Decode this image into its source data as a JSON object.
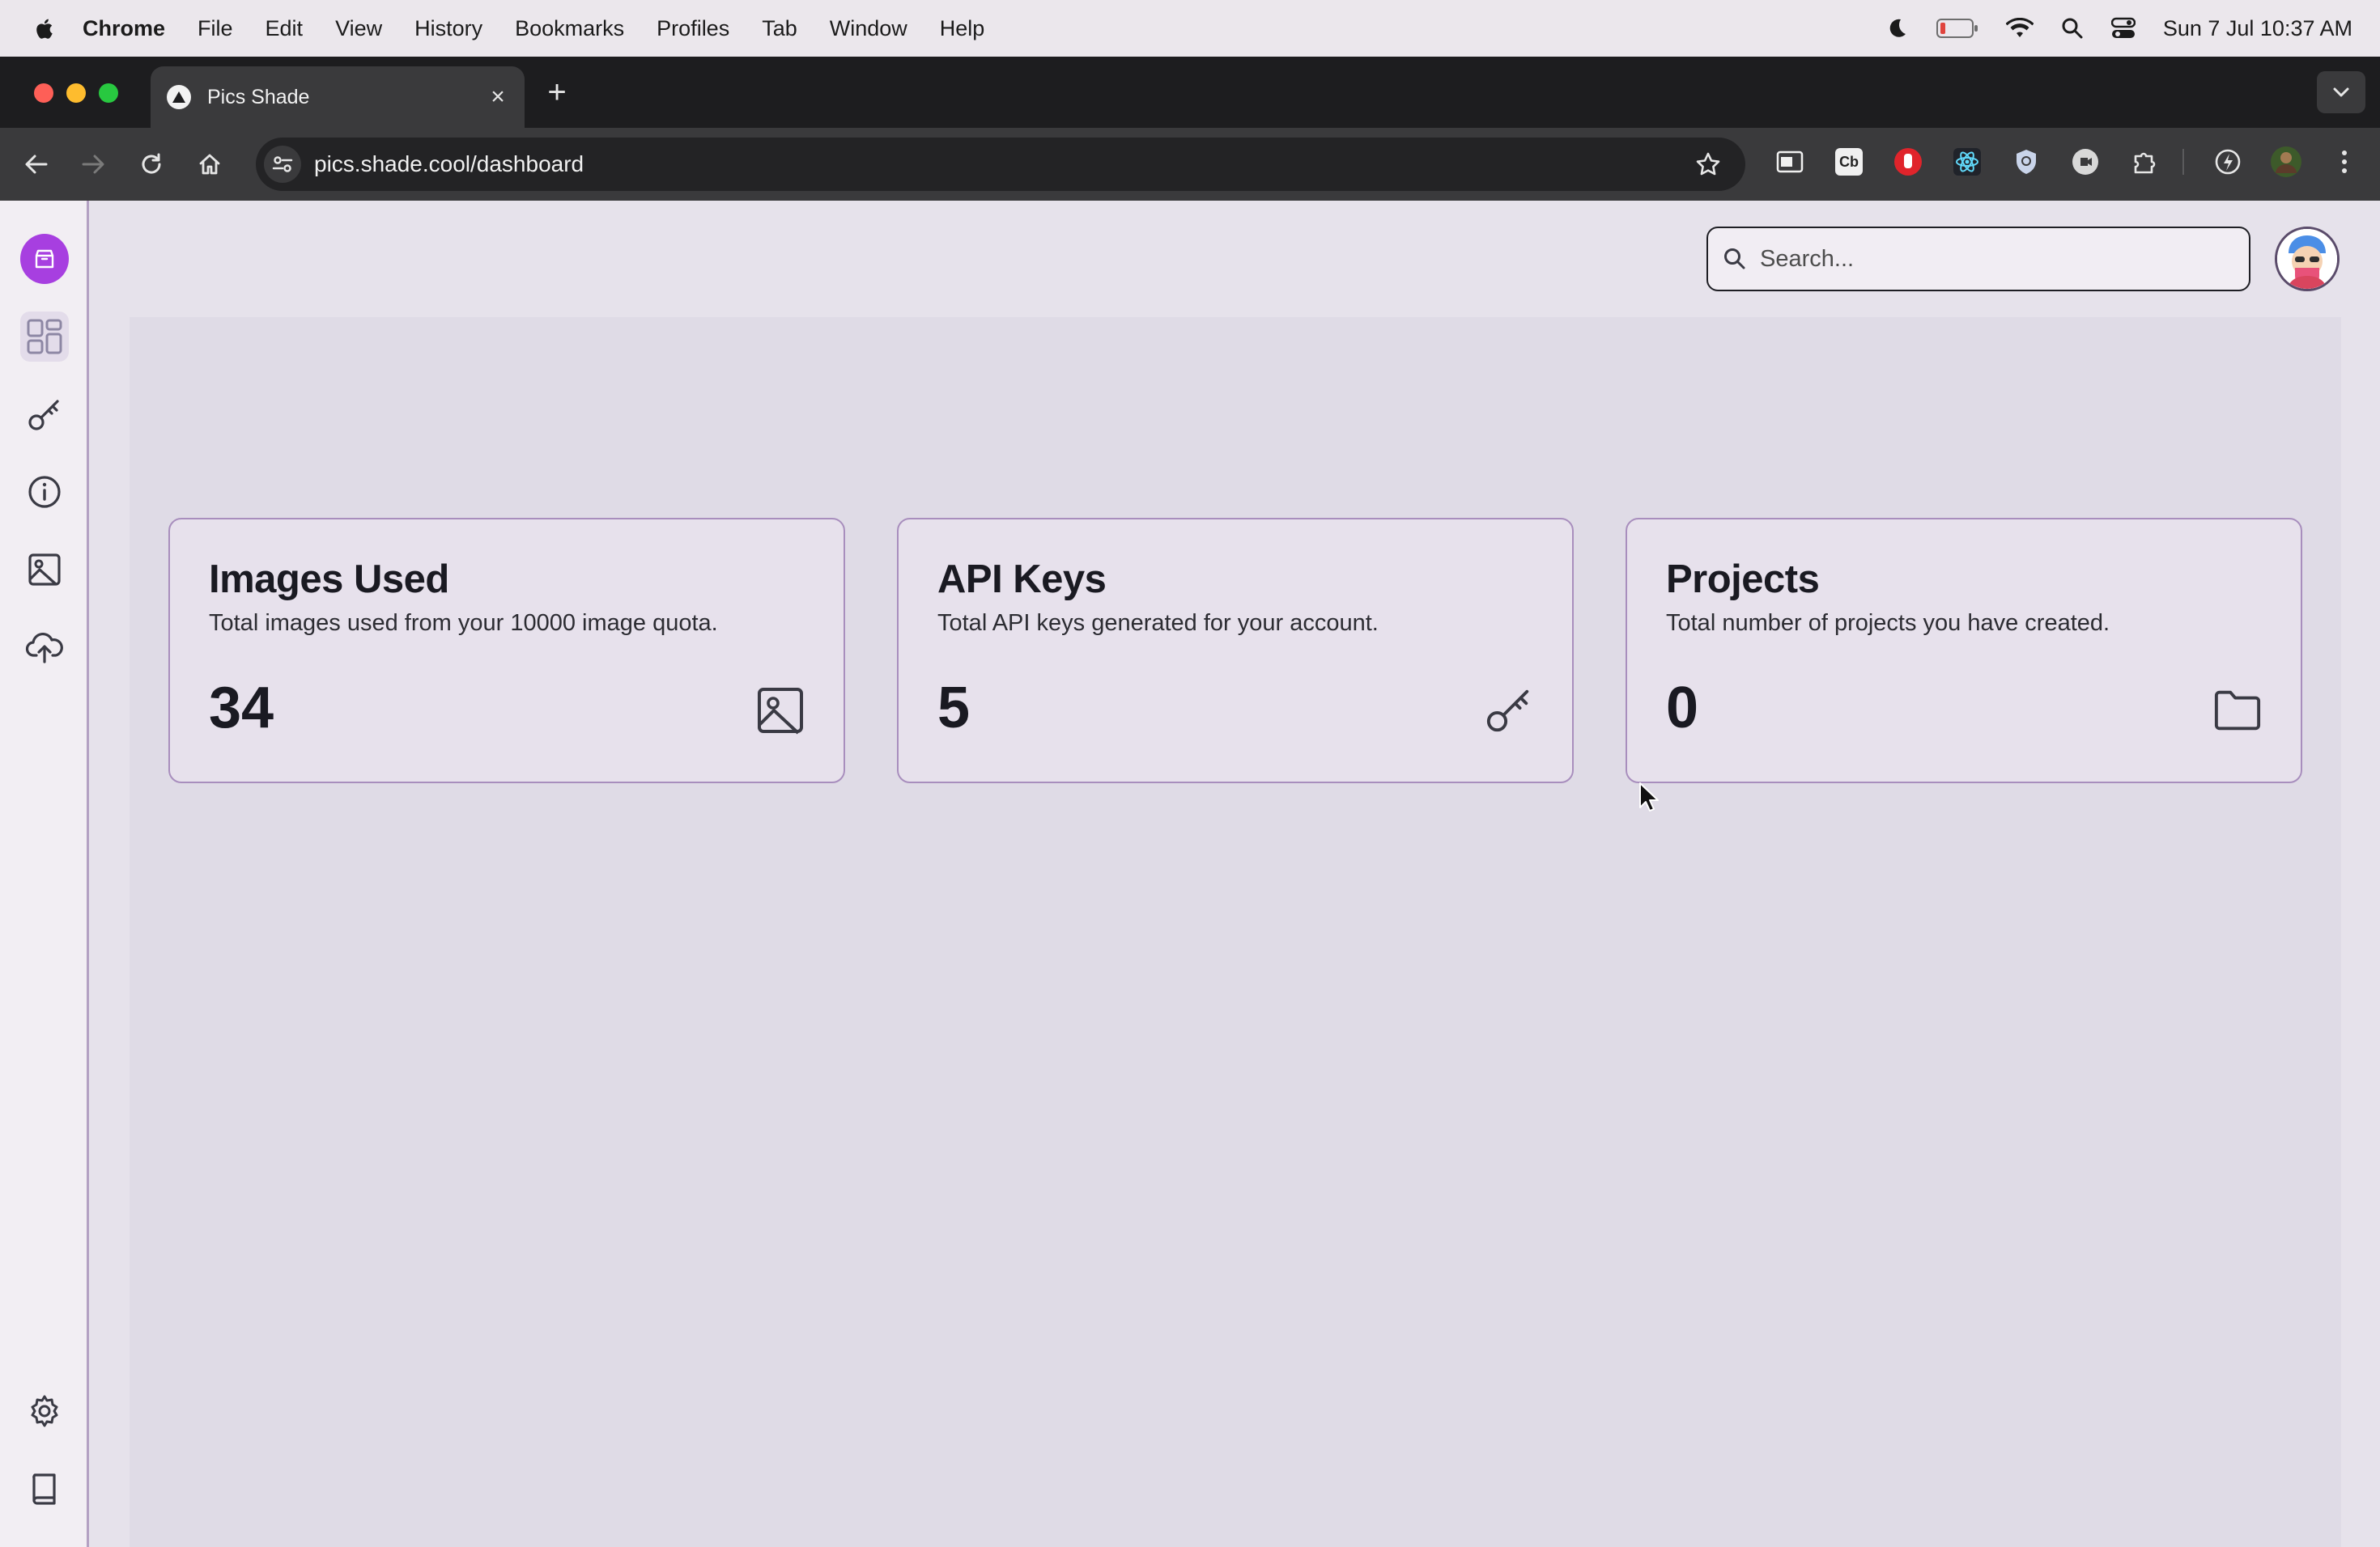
{
  "menubar": {
    "app": "Chrome",
    "items": [
      "File",
      "Edit",
      "View",
      "History",
      "Bookmarks",
      "Profiles",
      "Tab",
      "Window",
      "Help"
    ],
    "clock": "Sun 7 Jul  10:37 AM"
  },
  "browser": {
    "tab_title": "Pics Shade",
    "url": "pics.shade.cool/dashboard"
  },
  "extensions": [
    "Cb"
  ],
  "page": {
    "search_placeholder": "Search...",
    "cards": [
      {
        "title": "Images Used",
        "description": "Total images used from your 10000 image quota.",
        "value": "34",
        "icon": "image-icon"
      },
      {
        "title": "API Keys",
        "description": "Total API keys generated for your account.",
        "value": "5",
        "icon": "key-icon"
      },
      {
        "title": "Projects",
        "description": "Total number of projects you have created.",
        "value": "0",
        "icon": "folder-icon"
      }
    ]
  },
  "colors": {
    "brand": "#a73fe0",
    "card_border": "#a88ebd",
    "content_bg": "#dfdbe6"
  }
}
